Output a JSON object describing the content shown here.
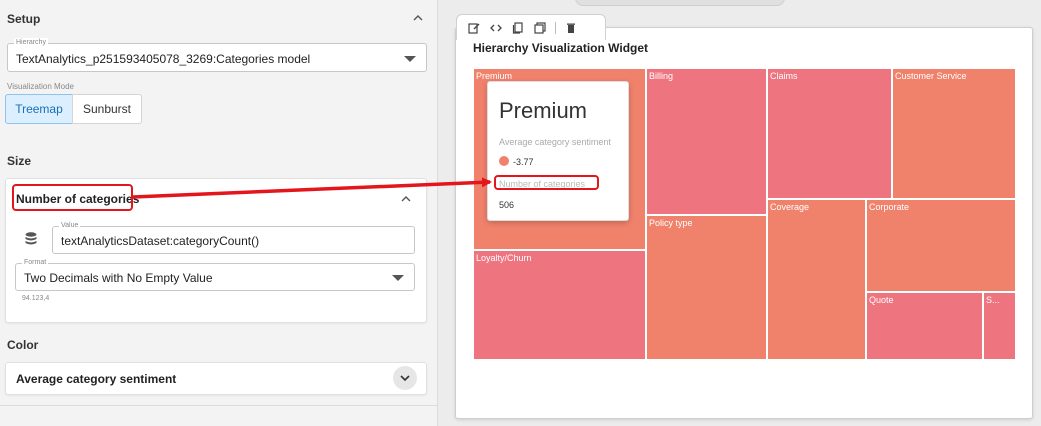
{
  "setup": {
    "section_title": "Setup",
    "hierarchy_legend": "Hierarchy",
    "hierarchy_value": "TextAnalytics_p251593405078_3269:Categories model",
    "viz_mode_label": "Visualization Mode",
    "viz_modes": [
      "Treemap",
      "Sunburst"
    ],
    "viz_mode_selected": "Treemap"
  },
  "size": {
    "section_title": "Size",
    "card_title": "Number of categories",
    "value_legend": "Value",
    "value": "textAnalyticsDataset:categoryCount()",
    "format_legend": "Format",
    "format_value": "Two Decimals with No Empty Value",
    "format_example": "94.123,4"
  },
  "color": {
    "section_title": "Color",
    "card_title": "Average category sentiment"
  },
  "widget": {
    "title": "Hierarchy Visualization Widget",
    "toolbar": [
      "edit-icon",
      "code-icon",
      "copy-icon",
      "duplicate-icon",
      "delete-icon"
    ]
  },
  "treemap": {
    "colors": {
      "salmon": "#f0826c",
      "pink": "#ee7580"
    },
    "tiles": [
      {
        "label": "Premium",
        "color": "salmon"
      },
      {
        "label": "Billing",
        "color": "pink"
      },
      {
        "label": "Claims",
        "color": "pink"
      },
      {
        "label": "Customer Service",
        "color": "salmon"
      },
      {
        "label": "Policy type",
        "color": "salmon"
      },
      {
        "label": "Coverage",
        "color": "salmon"
      },
      {
        "label": "Corporate",
        "color": "salmon"
      },
      {
        "label": "Loyalty/Churn",
        "color": "pink"
      },
      {
        "label": "Quote",
        "color": "pink"
      },
      {
        "label": "S...",
        "color": "pink"
      }
    ]
  },
  "tooltip": {
    "title": "Premium",
    "sentiment_label": "Average category sentiment",
    "sentiment_value": "-3.77",
    "count_label": "Number of categories",
    "count_value": "506",
    "dot_color": "#f0826c"
  },
  "annotation": {
    "color": "#e3161c"
  }
}
